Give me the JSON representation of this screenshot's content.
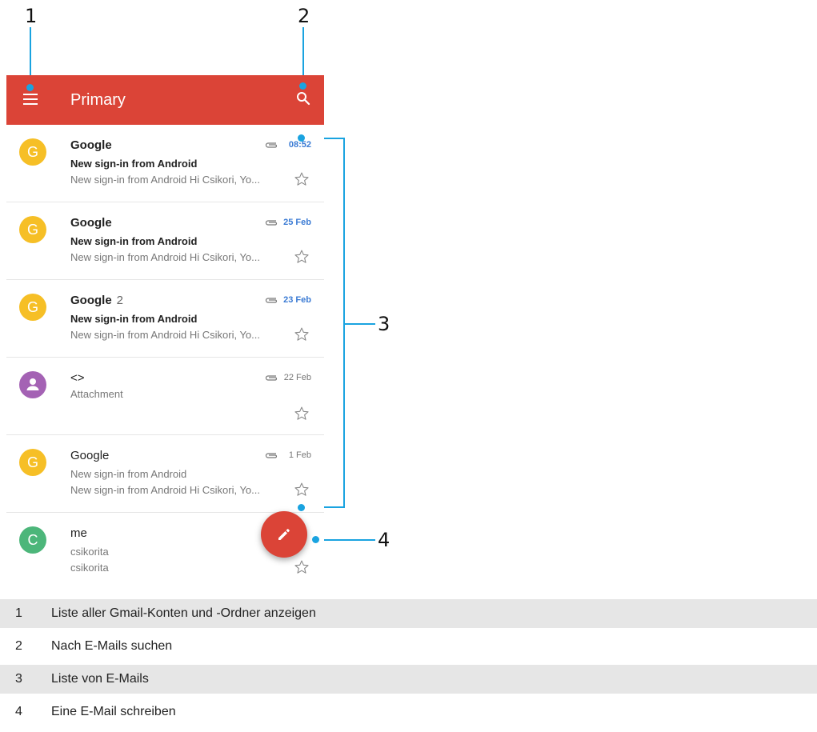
{
  "callouts": [
    "1",
    "2",
    "3",
    "4"
  ],
  "toolbar": {
    "title": "Primary",
    "color": "#db4437",
    "menu_icon": "menu-icon",
    "search_icon": "search-icon"
  },
  "emails": [
    {
      "sender": "Google",
      "count": "",
      "subject": "New sign-in from Android",
      "snippet": "New sign-in from Android Hi Csikori, Yo...",
      "date": "08:52",
      "unread": true,
      "avatar": "G",
      "avatar_color": "#f6bf26"
    },
    {
      "sender": "Google",
      "count": "",
      "subject": "New sign-in from Android",
      "snippet": "New sign-in from Android Hi Csikori, Yo...",
      "date": "25 Feb",
      "unread": true,
      "avatar": "G",
      "avatar_color": "#f6bf26"
    },
    {
      "sender": "Google",
      "count": "2",
      "subject": "New sign-in from Android",
      "snippet": "New sign-in from Android Hi Csikori, Yo...",
      "date": "23 Feb",
      "unread": true,
      "avatar": "G",
      "avatar_color": "#f6bf26"
    },
    {
      "sender": "<>",
      "count": "",
      "subject": "Attachment",
      "snippet": "",
      "date": "22 Feb",
      "unread": false,
      "avatar": "person-icon",
      "avatar_color": "#a462b4"
    },
    {
      "sender": "Google",
      "count": "",
      "subject": "New sign-in from Android",
      "snippet": "New sign-in from Android Hi Csikori, Yo...",
      "date": "1 Feb",
      "unread": false,
      "avatar": "G",
      "avatar_color": "#f6bf26"
    },
    {
      "sender": "me",
      "count": "",
      "subject": "csikorita",
      "snippet": "csikorita",
      "date": "",
      "unread": false,
      "avatar": "C",
      "avatar_color": "#4cb67a"
    }
  ],
  "fab": {
    "icon": "pencil-icon",
    "color": "#db4437"
  },
  "legend": [
    {
      "num": "1",
      "text": "Liste aller Gmail-Konten und -Ordner anzeigen"
    },
    {
      "num": "2",
      "text": "Nach E-Mails suchen"
    },
    {
      "num": "3",
      "text": "Liste von E-Mails"
    },
    {
      "num": "4",
      "text": "Eine E-Mail schreiben"
    }
  ],
  "accent_color": "#1aa3e0"
}
